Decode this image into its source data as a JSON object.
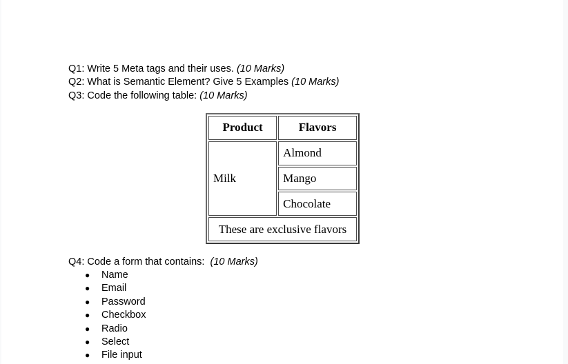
{
  "questions": {
    "q1": {
      "text": "Q1: Write 5 Meta tags and their uses.",
      "marks": "(10 Marks)"
    },
    "q2": {
      "text": "Q2: What is Semantic Element? Give 5 Examples",
      "marks": "(10 Marks)"
    },
    "q3": {
      "text": "Q3: Code the following table:",
      "marks": "(10 Marks)"
    },
    "q4": {
      "text": "Q4: Code a form that contains:",
      "marks": "(10 Marks)"
    }
  },
  "table": {
    "headers": [
      "Product",
      "Flavors"
    ],
    "product": "Milk",
    "flavors": [
      "Almond",
      "Mango",
      "Chocolate"
    ],
    "footer": "These are exclusive flavors"
  },
  "form_items": [
    "Name",
    "Email",
    "Password",
    "Checkbox",
    "Radio",
    "Select",
    "File input"
  ],
  "bullet_char": "●"
}
